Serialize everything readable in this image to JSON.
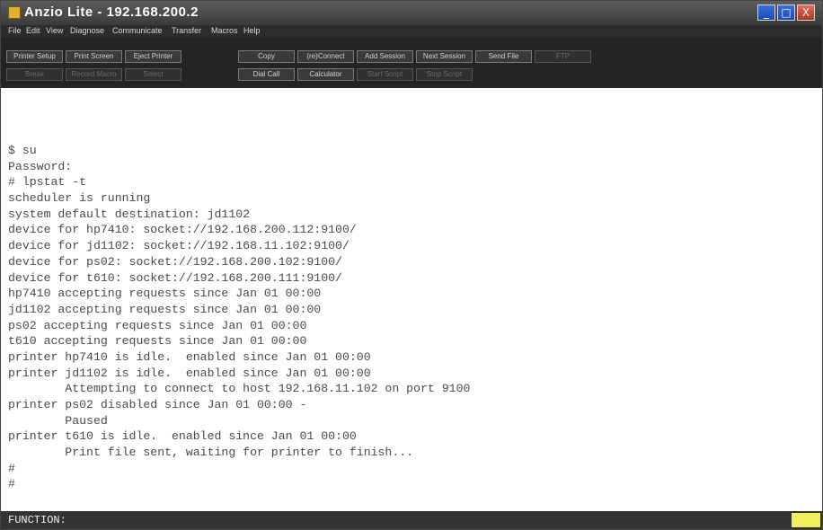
{
  "window": {
    "title": "Anzio Lite - 192.168.200.2",
    "minimize_glyph": "_",
    "maximize_glyph": "□",
    "close_glyph": "X",
    "icons": [
      "app-icon",
      "minimize-icon",
      "maximize-icon",
      "close-icon"
    ]
  },
  "menu": {
    "items": [
      "File",
      "Edit",
      "View",
      "Diagnose",
      "Communicate",
      "Transfer",
      "Macros",
      "Help"
    ]
  },
  "toolbar": {
    "row1": [
      {
        "label": "Printer Setup",
        "enabled": true
      },
      {
        "label": "Print Screen",
        "enabled": true
      },
      {
        "label": "Eject Printer",
        "enabled": true
      },
      {
        "label": "Copy",
        "enabled": true
      },
      {
        "label": "(re)Connect",
        "enabled": true
      },
      {
        "label": "Add Session",
        "enabled": true
      },
      {
        "label": "Next Session",
        "enabled": true
      },
      {
        "label": "Send File",
        "enabled": true
      },
      {
        "label": "FTP",
        "enabled": false
      }
    ],
    "row2": [
      {
        "label": "Break",
        "enabled": false
      },
      {
        "label": "Record Macro",
        "enabled": false
      },
      {
        "label": "Select",
        "enabled": false
      },
      {
        "label": "Dial Call",
        "enabled": true
      },
      {
        "label": "Calculator",
        "enabled": true
      },
      {
        "label": "Start Script",
        "enabled": false
      },
      {
        "label": "Stop Script",
        "enabled": false
      }
    ]
  },
  "terminal": {
    "lines": [
      "$ su",
      "Password:",
      "# lpstat -t",
      "scheduler is running",
      "system default destination: jd1102",
      "device for hp7410: socket://192.168.200.112:9100/",
      "device for jd1102: socket://192.168.11.102:9100/",
      "device for ps02: socket://192.168.200.102:9100/",
      "device for t610: socket://192.168.200.111:9100/",
      "hp7410 accepting requests since Jan 01 00:00",
      "jd1102 accepting requests since Jan 01 00:00",
      "ps02 accepting requests since Jan 01 00:00",
      "t610 accepting requests since Jan 01 00:00",
      "printer hp7410 is idle.  enabled since Jan 01 00:00",
      "printer jd1102 is idle.  enabled since Jan 01 00:00",
      "        Attempting to connect to host 192.168.11.102 on port 9100",
      "printer ps02 disabled since Jan 01 00:00 -",
      "        Paused",
      "printer t610 is idle.  enabled since Jan 01 00:00",
      "        Print file sent, waiting for printer to finish...",
      "#",
      "#"
    ]
  },
  "status": {
    "text": "FUNCTION:",
    "indicator_color": "#f2ef5c"
  }
}
